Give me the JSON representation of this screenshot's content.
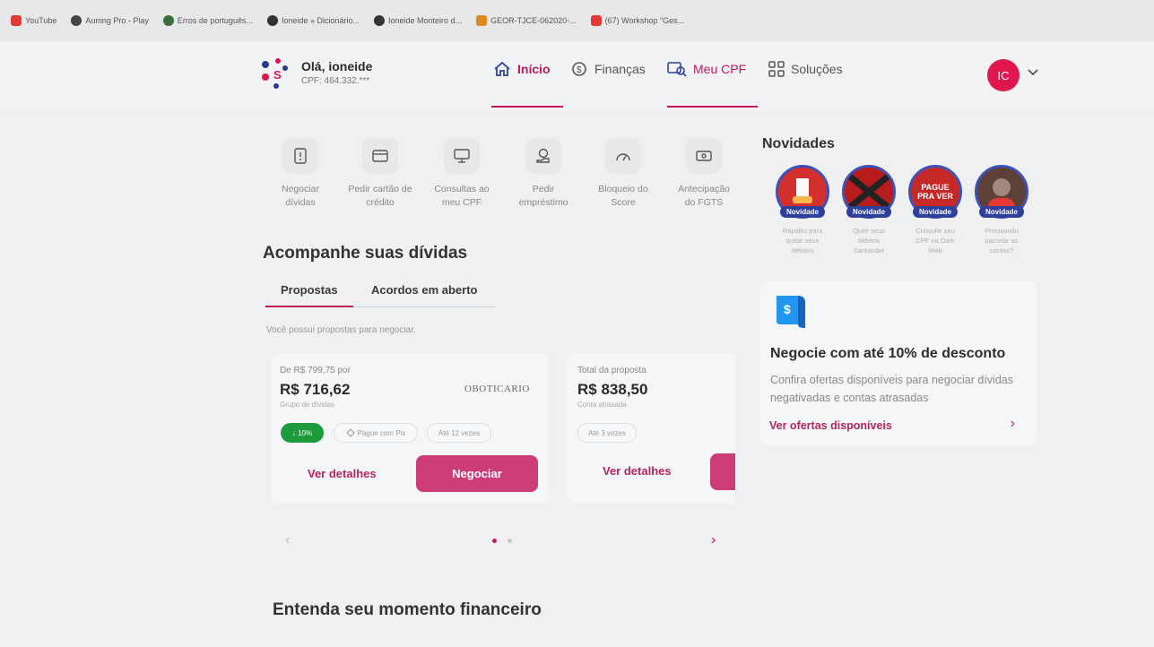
{
  "bookmarks": [
    {
      "label": "YouTube",
      "color": "#e53935"
    },
    {
      "label": "Aumng Pro - Play",
      "color": "#444444"
    },
    {
      "label": "Erros de português...",
      "color": "#3a6e3a"
    },
    {
      "label": "Ioneide » Dicionário...",
      "color": "#333333"
    },
    {
      "label": "Ioneide Monteiro d...",
      "color": "#333333"
    },
    {
      "label": "GEOR-TJCE-062020-...",
      "color": "#e08a1e"
    },
    {
      "label": "(67) Workshop \"Ges...",
      "color": "#e53935"
    }
  ],
  "user": {
    "greeting": "Olá, ioneide",
    "cpf": "CPF: 464.332.***",
    "initials": "IC"
  },
  "nav": [
    {
      "label": "Início",
      "icon": "home-icon",
      "active": true
    },
    {
      "label": "Finanças",
      "icon": "money-icon",
      "active": false
    },
    {
      "label": "Meu CPF",
      "icon": "cpf-search-icon",
      "active": false
    },
    {
      "label": "Soluções",
      "icon": "grid-icon",
      "active": false
    }
  ],
  "quick_actions": [
    {
      "line1": "Negociar",
      "line2": "dívidas",
      "icon": "document-alert-icon"
    },
    {
      "line1": "Pedir cartão de",
      "line2": "crédito",
      "icon": "card-icon"
    },
    {
      "line1": "Consultas ao",
      "line2": "meu CPF",
      "icon": "monitor-icon"
    },
    {
      "line1": "Pedir",
      "line2": "empréstimo",
      "icon": "money-hand-icon"
    },
    {
      "line1": "Bloqueio do",
      "line2": "Score",
      "icon": "gauge-icon"
    },
    {
      "line1": "Antecipação",
      "line2": "do FGTS",
      "icon": "cash-icon"
    }
  ],
  "debts": {
    "title": "Acompanhe suas dívidas",
    "tabs": [
      "Propostas",
      "Acordos em aberto"
    ],
    "info": "Você possui propostas para negociar.",
    "card1": {
      "from": "De R$ 799,75 por",
      "value": "R$ 716,62",
      "sub": "Grupo de dívidas",
      "brand": "OBOTICARIO",
      "discount": "↓ 10%",
      "pix": "Pague com Pix",
      "installments": "Até 12 vezes",
      "details": "Ver detalhes",
      "negotiate": "Negociar"
    },
    "card2": {
      "label": "Total da proposta",
      "value": "R$ 838,50",
      "sub": "Conta atrasada",
      "installments": "Até 3 vezes",
      "details": "Ver detalhes"
    },
    "carousel": {
      "prev": "‹",
      "next": "›"
    }
  },
  "bottom_heading": "Entenda seu momento financeiro",
  "news": {
    "title": "Novidades",
    "badge": "Novidade",
    "items": [
      {
        "line1": "Rapidez para",
        "line2": "quitar seus",
        "line3": "débitos"
      },
      {
        "line1": "Quite seus",
        "line2": "débitos",
        "line3": "Santander"
      },
      {
        "line1": "Consulte seu",
        "line2": "CPF na Dark",
        "line3": "Web"
      },
      {
        "line1": "Precisando",
        "line2": "parcelar as",
        "line3": "contas?"
      }
    ],
    "story3_text": "PAGUE PRA VER"
  },
  "promo": {
    "title": "Negocie com até 10% de desconto",
    "desc": "Confira ofertas disponíveis para negociar dívidas negativadas e contas atrasadas",
    "link": "Ver ofertas disponíveis"
  },
  "colors": {
    "brand": "#c2185b",
    "badge": "#2f3f9c",
    "discount": "#1d9a3c"
  }
}
